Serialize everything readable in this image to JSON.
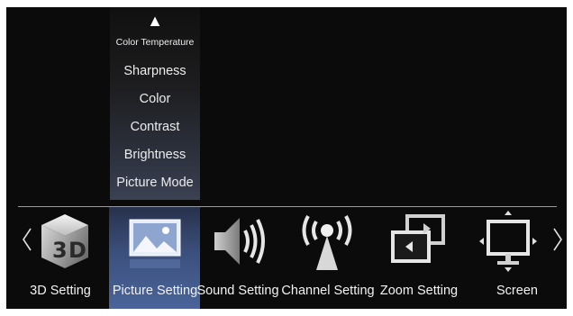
{
  "submenu": {
    "up_arrow": "▲",
    "items": [
      "Color Temperature",
      "Sharpness",
      "Color",
      "Contrast",
      "Brightness",
      "Picture Mode"
    ]
  },
  "menu": {
    "items": [
      {
        "label": "3D Setting",
        "icon": "3d-cube-icon"
      },
      {
        "label": "Picture Setting",
        "icon": "picture-icon",
        "selected": true
      },
      {
        "label": "Sound Setting",
        "icon": "speaker-icon"
      },
      {
        "label": "Channel Setting",
        "icon": "antenna-icon"
      },
      {
        "label": "Zoom Setting",
        "icon": "zoom-icon"
      },
      {
        "label": "Screen",
        "icon": "screen-position-icon"
      }
    ]
  },
  "colors": {
    "background": "#0b0b0b",
    "highlight": "#3c507d",
    "text": "#f2f2f2"
  }
}
